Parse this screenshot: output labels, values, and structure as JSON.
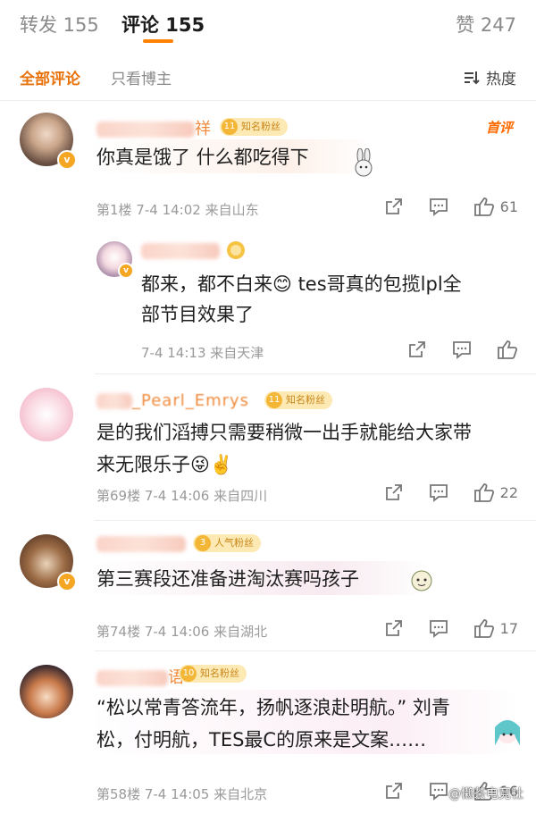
{
  "tabs": {
    "repost": "转发 155",
    "comment": "评论 155",
    "like": "赞 247"
  },
  "filters": {
    "all": "全部评论",
    "blogger_only": "只看博主",
    "sort": "热度"
  },
  "comments": [
    {
      "username_visible": "祥",
      "badge": "知名粉丝",
      "badge_level": "11",
      "first_tag": "首评",
      "text": "你真是饿了 什么都吃得下",
      "meta": "第1楼  7-4 14:02  来自山东",
      "likes": "61",
      "reply": {
        "username_visible": "",
        "text_line1": "都来，都不白来😊 tes哥真的包揽lpl全",
        "text_line2": "部节目效果了",
        "meta": "7-4 14:13  来自天津"
      }
    },
    {
      "username_visible": "_Pearl_Emrys",
      "badge": "知名粉丝",
      "badge_level": "11",
      "text_line1": "是的我们滔搏只需要稍微一出手就能给大家带",
      "text_line2": "来无限乐子😜✌️",
      "meta": "第69楼  7-4 14:06  来自四川",
      "likes": "22"
    },
    {
      "username_visible": "",
      "badge": "人气粉丝",
      "badge_level": "3",
      "text": "第三赛段还准备进淘汰赛吗孩子",
      "meta": "第74楼  7-4 14:06  来自湖北",
      "likes": "17"
    },
    {
      "username_visible": "语",
      "badge": "知名粉丝",
      "badge_level": "10",
      "text_line1": "“松以常青答流年，扬帆逐浪赴明航。” 刘青",
      "text_line2": "松，付明航，TES最C的原来是文案……",
      "meta": "第58楼  7-4 14:05  来自北京",
      "likes": "16"
    }
  ],
  "watermark": "@懒茶电竞社",
  "colors": {
    "accent": "#ff8200",
    "username": "#f08a3c",
    "meta": "#9a9a9a"
  }
}
